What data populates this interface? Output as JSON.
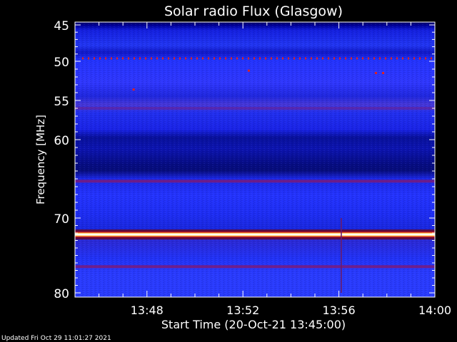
{
  "footer": {
    "updated": "Updated Fri Oct 29 11:01:27 2021"
  },
  "chart_data": {
    "type": "heatmap",
    "title": "Solar radio Flux (Glasgow)",
    "xlabel": "Start Time (20-Oct-21 13:45:00)",
    "ylabel": "Frequency [MHz]",
    "x_range_minutes": [
      0,
      15
    ],
    "x_ticks": [
      {
        "minute": 3,
        "label": "13:48"
      },
      {
        "minute": 7,
        "label": "13:52"
      },
      {
        "minute": 11,
        "label": "13:56"
      },
      {
        "minute": 15,
        "label": "14:00"
      }
    ],
    "ylim": [
      45,
      80
    ],
    "y_ticks": [
      45,
      50,
      55,
      60,
      70,
      80
    ],
    "y_tick_labels": [
      "45",
      "50",
      "55",
      "60",
      "70",
      "80"
    ],
    "y_scale": "nonlinear (frequency increases downward)",
    "colormap": [
      "#000050",
      "#0000c0",
      "#2030ff",
      "#5a1a9a",
      "#b01010",
      "#ffd060",
      "#ffffff"
    ],
    "features": [
      {
        "kind": "constant-emission",
        "frequency_mhz": 72.2,
        "intensity": "saturated (white/yellow)"
      },
      {
        "kind": "moderate-band",
        "frequency_mhz": 65.3,
        "intensity": "medium"
      },
      {
        "kind": "moderate-band",
        "frequency_mhz": 76.5,
        "intensity": "medium"
      },
      {
        "kind": "moderate-band",
        "frequency_mhz": 56.0,
        "intensity": "low"
      },
      {
        "kind": "dotted-interference",
        "frequency_mhz": 49.6,
        "intensity": "medium"
      },
      {
        "kind": "broadband-spike",
        "time_minute": 11.1,
        "intensity": "medium"
      }
    ]
  }
}
